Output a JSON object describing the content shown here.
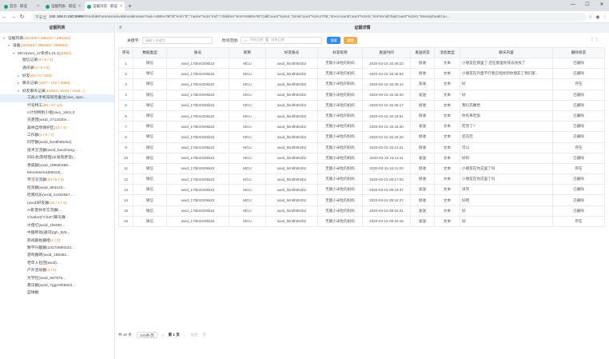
{
  "browser": {
    "tabs": [
      {
        "label": "首页 · 取证",
        "active": false
      },
      {
        "label": "证据列表 · 取证",
        "active": false
      },
      {
        "label": "证据浏览 · 取证",
        "active": true
      }
    ],
    "new_tab": "+",
    "url_info": "不安全",
    "url_host": "192.168.0.100:9999",
    "url_path": "/#/mobileForensics/evidenceBrowse?val=%5B%7B\"id\"%3A\"8\",\"name\"%3A\"rnd\",\"children\"%3A%5B%7B\"CallCount\"%3A4,\"SmsCount\"%3A1708,\"ImAccountCount\"%3A0,\"ImFriendChatCount\"%3A0,\"MoneyDealCou..."
  },
  "left": {
    "title": "证据列表",
    "tree": [
      {
        "indent": 0,
        "arrow": "▾",
        "label": "证据列表",
        "count": "(457449 / 286222 / 286221)",
        "selected": false
      },
      {
        "indent": 1,
        "arrow": "▾",
        "label": "设备",
        "count": "(454563 / 288163 / 286622)",
        "selected": false
      },
      {
        "indent": 2,
        "arrow": "▾",
        "label": "MCU(vivo_17系统1.01.1)",
        "count": "(1881)",
        "selected": false
      },
      {
        "indent": 3,
        "arrow": "",
        "label": "短信记录",
        "count": "(4 / 0 / 1)",
        "selected": false
      },
      {
        "indent": 3,
        "arrow": "",
        "label": "通讯录",
        "count": "(0 / 0 / 0)",
        "selected": false
      },
      {
        "indent": 3,
        "arrow": "▸",
        "label": "好友",
        "count": "(60 / 0 / 503)",
        "selected": false
      },
      {
        "indent": 3,
        "arrow": "▸",
        "label": "聊天记录",
        "count": "(1057 / 152 / 2068)",
        "selected": false
      },
      {
        "indent": 3,
        "arrow": "▾",
        "label": "好友聊天记录",
        "count": "(10083 / 9233 / 1115...)",
        "selected": false
      },
      {
        "indent": 4,
        "arrow": "",
        "label": "工具人手机号码无备注(vivo_iqoo...",
        "count": "",
        "selected": true
      },
      {
        "indent": 4,
        "arrow": "",
        "label": "代号特工",
        "count": "(30 / 0 / 14)",
        "selected": false
      },
      {
        "indent": 4,
        "arrow": "",
        "label": "A计划特别小组(vivo_1901.3",
        "count": "",
        "selected": false
      },
      {
        "indent": 4,
        "arrow": "",
        "label": "兄弟团(wxid_2712dzbn...",
        "count": "",
        "selected": false
      },
      {
        "indent": 4,
        "arrow": "",
        "label": "森林自然保护区",
        "count": "(13 / 4)",
        "selected": false
      },
      {
        "indent": 4,
        "arrow": "",
        "label": "工作群",
        "count": "(1 / 0 / 7)",
        "selected": false
      },
      {
        "indent": 4,
        "arrow": "",
        "label": "同学群(wxid_lkmtlh80zb2)",
        "count": "",
        "selected": false
      },
      {
        "indent": 4,
        "arrow": "",
        "label": "技术交流群(wxid_baozhang...",
        "count": "",
        "selected": false
      },
      {
        "indent": 4,
        "arrow": "",
        "label": "同乐会(陈经理)从发现异常(...",
        "count": "",
        "selected": false
      },
      {
        "indent": 4,
        "arrow": "",
        "label": "亲戚群(wxid_1f9650398...",
        "count": "",
        "selected": false
      },
      {
        "indent": 4,
        "arrow": "",
        "label": "Mmontserrat06033(...",
        "count": "",
        "selected": false
      },
      {
        "indent": 4,
        "arrow": "",
        "label": "学习交流群",
        "count": "(10 / 5 / 3)",
        "selected": false
      },
      {
        "indent": 4,
        "arrow": "",
        "label": "吃货群(wxid_883123...",
        "count": "",
        "selected": false
      },
      {
        "indent": 4,
        "arrow": "",
        "label": "吃喝玩乐(wxid_zz2026k7...",
        "count": "",
        "selected": false
      },
      {
        "indent": 4,
        "arrow": "",
        "label": "(wxid)好友群",
        "count": "(13 / 1 / 1)",
        "selected": false
      },
      {
        "indent": 4,
        "arrow": "",
        "label": "AI影音共享交流群(...",
        "count": "",
        "selected": false
      },
      {
        "indent": 4,
        "arrow": "",
        "label": "Chatbot(\"Chat\")聊天群",
        "count": "",
        "selected": false
      },
      {
        "indent": 4,
        "arrow": "",
        "label": "大佬们(wxid_1f9450...",
        "count": "",
        "selected": false
      },
      {
        "indent": 4,
        "arrow": "",
        "label": "中国移动(通讯)(gh_825...",
        "count": "",
        "selected": false
      },
      {
        "indent": 4,
        "arrow": "",
        "label": "影视剧拍摄组",
        "count": "(1 / 0)",
        "selected": false
      },
      {
        "indent": 4,
        "arrow": "",
        "label": "数学兴趣群(13170980333...",
        "count": "",
        "selected": false
      },
      {
        "indent": 4,
        "arrow": "",
        "label": "游戏搬砖(wxid_188352...",
        "count": "",
        "selected": false
      },
      {
        "indent": 4,
        "arrow": "",
        "label": "老年人社团(wxid)...",
        "count": "",
        "selected": false
      },
      {
        "indent": 4,
        "arrow": "",
        "label": "户外活动群",
        "count": "(1 / 1)",
        "selected": false
      },
      {
        "indent": 4,
        "arrow": "",
        "label": "文学社(wxid_567975...",
        "count": "",
        "selected": false
      },
      {
        "indent": 4,
        "arrow": "",
        "label": "夏日群(wxid_7ggzr9h50e2...",
        "count": "",
        "selected": false
      },
      {
        "indent": 4,
        "arrow": "",
        "label": "篮球群",
        "count": "",
        "selected": false
      }
    ]
  },
  "main": {
    "title": "证据详情",
    "menu_icon": "≡",
    "filter": {
      "keyword_label": "关键字:",
      "keyword_placeholder": "请输入关键字",
      "time_label": "时间范围:",
      "date_start": "开始日期",
      "date_sep": "至",
      "date_end": "结束日期",
      "search_btn": "搜索",
      "reset_btn": "重置"
    },
    "columns": [
      "序号",
      "数据类型",
      "账号",
      "昵称",
      "好友账号",
      "好友昵称",
      "发送时间",
      "发送状态",
      "消息类型",
      "聊天内容",
      "删除状态"
    ],
    "rows": [
      [
        "1",
        "微信",
        "wxid_17tbm0z0kk22",
        "MCU",
        "wxid_lkmtlh80zb2",
        "无敌小米粒的妈妈",
        "2020-03-15 15:46:23",
        "接收",
        "文本",
        "小朋友在那里了,还在那里你快去找找了",
        "已删除"
      ],
      [
        "2",
        "微信",
        "wxid_17tbm0z0kk22",
        "MCU",
        "wxid_lkmtlh80zb2",
        "无敌小米粒的妈妈",
        "2020-03-15 15:45:54",
        "接收",
        "文本",
        "小朋友在外面不行我已经找到你朋友了我们家...",
        "已删除"
      ],
      [
        "3",
        "微信",
        "wxid_17tbm0z0kk22",
        "MCU",
        "wxid_lkmtlh80zb2",
        "无敌小米粒的妈妈",
        "2020-03-15 15:45:42",
        "发送",
        "文本",
        "好",
        "存在"
      ],
      [
        "4",
        "微信",
        "wxid_17tbm0z0kk22",
        "MCU",
        "wxid_lkmtlh80zb2",
        "无敌小米粒的妈妈",
        "2020-03-15 15:45:40",
        "发送",
        "文本",
        "好",
        "已删除"
      ],
      [
        "5",
        "微信",
        "wxid_17tbm0z0kk22",
        "MCU",
        "wxid_lkmtlh80zb2",
        "无敌小米粒的妈妈",
        "2020-03-15 15:45:17",
        "接收",
        "文本",
        "我们先睡觉",
        "已删除"
      ],
      [
        "6",
        "微信",
        "wxid_17tbm0z0kk22",
        "MCU",
        "wxid_lkmtlh80zb2",
        "无敌小米粒的妈妈",
        "2020-03-15 15:44:51",
        "接收",
        "文本",
        "你先来吃饭",
        "已删除"
      ],
      [
        "7",
        "微信",
        "wxid_17tbm0z0kk22",
        "MCU",
        "wxid_lkmtlh80zb2",
        "无敌小米粒的妈妈",
        "2020-03-15 15:44:30",
        "发送",
        "文本",
        "吃完了?",
        "已删除"
      ],
      [
        "8",
        "微信",
        "wxid_17tbm0z0kk22",
        "MCU",
        "wxid_lkmtlh80zb2",
        "无敌小米粒的妈妈",
        "2020-03-15 15:44:20",
        "接收",
        "文本",
        "还在吃",
        "已删除"
      ],
      [
        "9",
        "微信",
        "wxid_17tbm0z0kk22",
        "MCU",
        "wxid_lkmtlh80zb2",
        "无敌小米粒的妈妈",
        "2020-03-15 15:21:21",
        "接收",
        "文本",
        "可以",
        "存在"
      ],
      [
        "10",
        "微信",
        "wxid_17tbm0z0kk22",
        "MCU",
        "wxid_lkmtlh80zb2",
        "无敌小米粒的妈妈",
        "2020-03-15 15:11:11",
        "发送",
        "文本",
        "好的",
        "已删除"
      ],
      [
        "11",
        "微信",
        "wxid_17tbm0z0kk22",
        "MCU",
        "wxid_lkmtlh80zb2",
        "无敌小米粒的妈妈",
        "2020-03-15 15:11:00",
        "接收",
        "文本",
        "小朋友在你这里了吗",
        "存在"
      ],
      [
        "12",
        "微信",
        "wxid_17tbm0z0kk22",
        "MCU",
        "wxid_lkmtlh80zb2",
        "无敌小米粒的妈妈",
        "2020-03-15 09:17:02",
        "接收",
        "文本",
        "小朋友在你这里了吗",
        "已删除"
      ],
      [
        "13",
        "微信",
        "wxid_17tbm0z0kk22",
        "MCU",
        "wxid_lkmtlh80zb2",
        "无敌小米粒的妈妈",
        "2020-03-15 09:16:37",
        "发送",
        "文本",
        "没有",
        "已删除"
      ],
      [
        "14",
        "微信",
        "wxid_17tbm0z0kk22",
        "MCU",
        "wxid_lkmtlh80zb2",
        "无敌小米粒的妈妈",
        "2020-03-15 09:16:37",
        "接收",
        "文本",
        "好吧",
        "已删除"
      ],
      [
        "15",
        "微信",
        "wxid_17tbm0z0kk22",
        "MCU",
        "wxid_lkmtlh80zb2",
        "无敌小米粒的妈妈",
        "2020-03-15 09:16:21",
        "发送",
        "文本",
        "好",
        "已删除"
      ],
      [
        "16",
        "微信",
        "wxid_17tbm0z0kk22",
        "MCU",
        "wxid_lkmtlh80zb2",
        "无敌小米粒的妈妈",
        "2020-03-15 09:16:15",
        "发送",
        "文本",
        "好",
        "存在"
      ]
    ],
    "pager": {
      "total": "共 16 条",
      "page_size": "100条/页",
      "prev": "‹",
      "current": "第 1 页",
      "next": "›",
      "goto": "前往",
      "page_unit": "页"
    }
  }
}
